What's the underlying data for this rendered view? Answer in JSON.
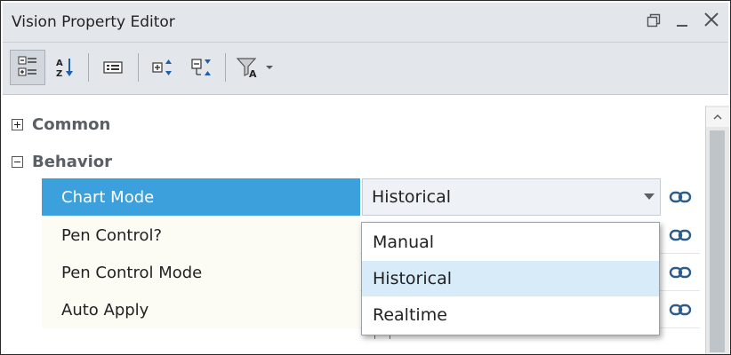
{
  "window": {
    "title": "Vision Property Editor",
    "restore_icon": "restore-icon",
    "minimize_icon": "minimize-icon",
    "close_icon": "close-icon"
  },
  "toolbar": {
    "buttons": [
      {
        "name": "categorized-view-button",
        "icon": "categorized-icon",
        "active": true
      },
      {
        "name": "sort-alphabetical-button",
        "icon": "sort-az-icon"
      },
      {
        "name": "property-description-button",
        "icon": "description-icon"
      },
      {
        "name": "expand-all-button",
        "icon": "expand-all-icon"
      },
      {
        "name": "collapse-all-button",
        "icon": "collapse-all-icon"
      },
      {
        "name": "filter-button",
        "icon": "filter-icon"
      },
      {
        "name": "filter-dropdown-button",
        "icon": "chevron-down-icon"
      }
    ]
  },
  "categories": {
    "common": "Common",
    "behavior": "Behavior"
  },
  "properties": [
    {
      "name": "Chart Mode",
      "value": "Historical",
      "selected": true
    },
    {
      "name": "Pen Control?"
    },
    {
      "name": "Pen Control Mode"
    },
    {
      "name": "Auto Apply",
      "value": "false"
    }
  ],
  "dropdown": {
    "options": [
      "Manual",
      "Historical",
      "Realtime"
    ],
    "highlighted": "Historical"
  },
  "colors": {
    "selected_row": "#3ca0dc",
    "highlight_option": "#d8ebf9",
    "toolbar_bg": "#e3e7ec"
  }
}
